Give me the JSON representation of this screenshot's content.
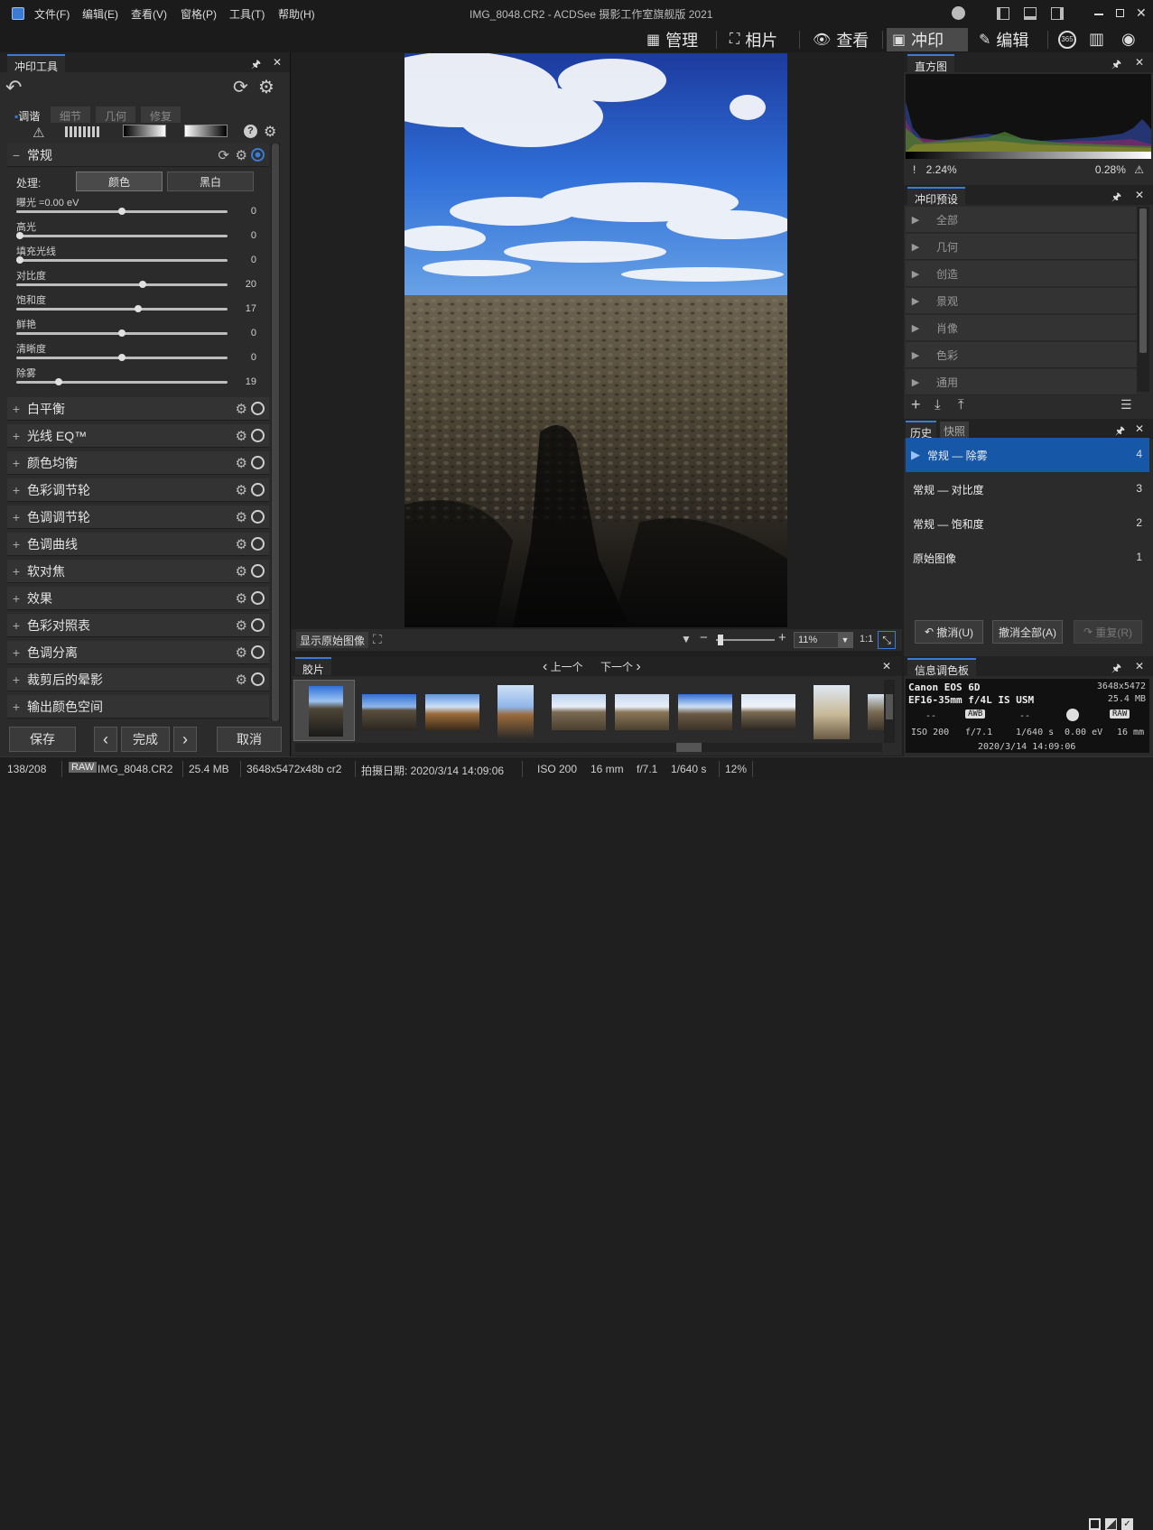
{
  "menu": [
    "文件(F)",
    "编辑(E)",
    "查看(V)",
    "窗格(P)",
    "工具(T)",
    "帮助(H)"
  ],
  "window_title": "IMG_8048.CR2 - ACDSee 摄影工作室旗舰版 2021",
  "modes": [
    {
      "icon": "grid-icon",
      "label": "管理"
    },
    {
      "icon": "photo-tag-icon",
      "label": "相片"
    },
    {
      "icon": "eye-icon",
      "label": "查看"
    },
    {
      "icon": "develop-icon",
      "label": "冲印"
    },
    {
      "icon": "edit-icon",
      "label": "编辑"
    }
  ],
  "mode_extra": {
    "badge": "365"
  },
  "left": {
    "panel_title": "冲印工具",
    "subtabs": [
      "调谐",
      "细节",
      "几何",
      "修复"
    ],
    "general": {
      "title": "常规",
      "process_label": "处理:",
      "process_options": [
        "颜色",
        "黑白"
      ],
      "sliders": [
        {
          "label": "曝光 =0.00 eV",
          "value": "0",
          "level": 50
        },
        {
          "label": "高光",
          "value": "0",
          "level": 0
        },
        {
          "label": "填充光线",
          "value": "0",
          "level": 0
        },
        {
          "label": "对比度",
          "value": "20",
          "level": 60
        },
        {
          "label": "饱和度",
          "value": "17",
          "level": 58
        },
        {
          "label": "鲜艳",
          "value": "0",
          "level": 50
        },
        {
          "label": "清晰度",
          "value": "0",
          "level": 50
        },
        {
          "label": "除雾",
          "value": "19",
          "level": 19
        }
      ]
    },
    "sections": [
      "白平衡",
      "光线 EQ™",
      "颜色均衡",
      "色彩调节轮",
      "色调调节轮",
      "色调曲线",
      "软对焦",
      "效果",
      "色彩对照表",
      "色调分离",
      "裁剪后的晕影",
      "输出颜色空间"
    ],
    "buttons": {
      "save": "保存",
      "prev": "‹",
      "done": "完成",
      "next": "›",
      "cancel": "取消"
    }
  },
  "viewer": {
    "show_original": "显示原始图像",
    "zoom": "11%",
    "ratio": "1:1"
  },
  "filmstrip": {
    "title": "胶片",
    "prev": "上一个",
    "next": "下一个"
  },
  "right": {
    "histogram": {
      "title": "直方图",
      "left_clip": "2.24%",
      "right_clip": "0.28%"
    },
    "presets": {
      "title": "冲印预设",
      "items": [
        "全部",
        "几何",
        "创造",
        "景观",
        "肖像",
        "色彩",
        "通用"
      ]
    },
    "history": {
      "tabs": [
        "历史",
        "快照"
      ],
      "items": [
        {
          "label": "常规 — 除雾",
          "num": "4"
        },
        {
          "label": "常规 — 对比度",
          "num": "3"
        },
        {
          "label": "常规 — 饱和度",
          "num": "2"
        },
        {
          "label": "原始图像",
          "num": "1"
        }
      ],
      "buttons": {
        "undo": "撤消(U)",
        "undo_all": "撤消全部(A)",
        "redo": "重复(R)"
      }
    },
    "info": {
      "title": "信息调色板",
      "camera": "Canon EOS 6D",
      "lens": "EF16-35mm f/4L IS USM",
      "dims": "3648x5472",
      "size": "25.4 MB",
      "wb": "AWB",
      "metering": "--",
      "flash": "--",
      "format": "RAW",
      "iso": "ISO 200",
      "aperture": "f/7.1",
      "shutter": "1/640 s",
      "ev": "0.00 eV",
      "focal": "16 mm",
      "date": "2020/3/14 14:09:06"
    }
  },
  "status": {
    "count": "138/208",
    "raw": "RAW",
    "filename": "IMG_8048.CR2",
    "filesize": "25.4 MB",
    "dims": "3648x5472x48b cr2",
    "date": "拍摄日期: 2020/3/14 14:09:06",
    "iso": "ISO 200",
    "focal": "16 mm",
    "aperture": "f/7.1",
    "shutter": "1/640 s",
    "zoom": "12%"
  },
  "colors": {
    "accent": "#3a7bd5",
    "history_selected": "#1657a8",
    "panel": "#2b2b2b"
  }
}
